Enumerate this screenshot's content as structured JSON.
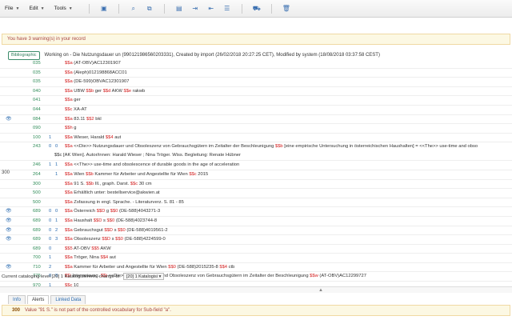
{
  "menus": [
    {
      "label": "File"
    },
    {
      "label": "Edit"
    },
    {
      "label": "Tools"
    }
  ],
  "warning": "You have 3 warning(s) in your record",
  "record": {
    "badge": "Bibliographic",
    "status": "Working on - Die Nutzungsdauer un (990121986560203331), Created by import (26/02/2018 20:27:25 CET), Modified by system (18/08/2018 03:37:58 CEST)"
  },
  "fields": [
    {
      "eye": false,
      "tag": "035",
      "i1": "",
      "i2": "",
      "parts": [
        [
          "$$a",
          " (AT-OBV)AC12301907"
        ]
      ]
    },
    {
      "eye": false,
      "tag": "035",
      "i1": "",
      "i2": "",
      "parts": [
        [
          "$$a",
          " (Aleph)012198868ACC01"
        ]
      ]
    },
    {
      "eye": false,
      "tag": "035",
      "i1": "",
      "i2": "",
      "parts": [
        [
          "$$a",
          " (DE-599)OBVAC12301907"
        ]
      ]
    },
    {
      "eye": false,
      "tag": "040",
      "i1": "",
      "i2": "",
      "parts": [
        [
          "$$a",
          " UBW "
        ],
        [
          "$$b",
          " ger "
        ],
        [
          "$$d",
          " AKW "
        ],
        [
          "$$e",
          " rakwb"
        ]
      ]
    },
    {
      "eye": false,
      "tag": "041",
      "i1": "",
      "i2": "",
      "parts": [
        [
          "$$a",
          " ger"
        ]
      ]
    },
    {
      "eye": false,
      "tag": "044",
      "i1": "",
      "i2": "",
      "parts": [
        [
          "$$c",
          " XA-AT"
        ]
      ]
    },
    {
      "eye": true,
      "tag": "084",
      "i1": "",
      "i2": "",
      "parts": [
        [
          "$$a",
          " 83.11 "
        ],
        [
          "$$2",
          " bkl"
        ]
      ]
    },
    {
      "eye": false,
      "tag": "090",
      "i1": "",
      "i2": "",
      "parts": [
        [
          "$$h",
          " g"
        ]
      ]
    },
    {
      "eye": false,
      "tag": "100",
      "i1": "1",
      "i2": "",
      "parts": [
        [
          "$$a",
          " Wieser, Harald "
        ],
        [
          "$$4",
          " aut"
        ]
      ]
    },
    {
      "eye": false,
      "tag": "243",
      "i1": "0",
      "i2": "0",
      "tall": true,
      "parts": [
        [
          "$$a",
          " <<Die>> Nutzungsdauer und Obsoleszenz von Gebrauchsgütern im Zeitalter der Beschleunigung "
        ],
        [
          "$$b",
          " [eine empirische Untersuchung in österreichischen Haushalten] = <<The>> use-time and obso"
        ]
      ],
      "parts2": [
        [
          "$$c",
          " [AK Wien]. Autor/innen: Harald Wieser ; Nina Tröger. Wiss. Begleitung: Renate Hübner"
        ]
      ]
    },
    {
      "eye": false,
      "tag": "246",
      "i1": "1",
      "i2": "1",
      "parts": [
        [
          "$$a",
          " <<The>> use-time and obsolescence of durable goods in the age of acceleration"
        ]
      ]
    },
    {
      "eye": false,
      "tag": "264",
      "i1": "",
      "i2": "1",
      "parts": [
        [
          "$$a",
          " Wien "
        ],
        [
          "$$b",
          " Kammer für Arbeiter und Angestellte für Wien "
        ],
        [
          "$$c",
          " 2015"
        ]
      ]
    },
    {
      "eye": false,
      "tag": "300",
      "i1": "",
      "i2": "",
      "parts": [
        [
          "$$a",
          " 91 S. "
        ],
        [
          "$$b",
          " Ill., graph. Darst. "
        ],
        [
          "$$c",
          " 30 cm"
        ]
      ]
    },
    {
      "eye": false,
      "tag": "500",
      "i1": "",
      "i2": "",
      "parts": [
        [
          "$$a",
          " Erhältlich unter: bestellservice@akwien.at"
        ]
      ]
    },
    {
      "eye": false,
      "tag": "500",
      "i1": "",
      "i2": "",
      "parts": [
        [
          "$$a",
          " Zsfassung in engl. Sprache. - Literaturverz. S. 81 - 85"
        ]
      ]
    },
    {
      "eye": true,
      "tag": "689",
      "i1": "0",
      "i2": "0",
      "parts": [
        [
          "$$a",
          " Österreich "
        ],
        [
          "$$D",
          " g "
        ],
        [
          "$$0",
          " (DE-588)4043271-3"
        ]
      ]
    },
    {
      "eye": true,
      "tag": "689",
      "i1": "0",
      "i2": "1",
      "parts": [
        [
          "$$a",
          " Haushalt "
        ],
        [
          "$$D",
          " s "
        ],
        [
          "$$0",
          " (DE-588)4023744-8"
        ]
      ]
    },
    {
      "eye": true,
      "tag": "689",
      "i1": "0",
      "i2": "2",
      "parts": [
        [
          "$$a",
          " Gebrauchsgut "
        ],
        [
          "$$D",
          " s "
        ],
        [
          "$$0",
          " (DE-588)4019561-2"
        ]
      ]
    },
    {
      "eye": true,
      "tag": "689",
      "i1": "0",
      "i2": "3",
      "parts": [
        [
          "$$a",
          " Obsoleszenz "
        ],
        [
          "$$D",
          " s "
        ],
        [
          "$$0",
          " (DE-588)4224599-0"
        ]
      ]
    },
    {
      "eye": false,
      "tag": "689",
      "i1": "0",
      "i2": "",
      "parts": [
        [
          "$$5",
          " AT-OBV "
        ],
        [
          "$$5",
          " AKW"
        ]
      ]
    },
    {
      "eye": false,
      "tag": "700",
      "i1": "1",
      "i2": "",
      "parts": [
        [
          "$$a",
          " Tröger, Nina "
        ],
        [
          "$$4",
          " aut"
        ]
      ]
    },
    {
      "eye": true,
      "tag": "710",
      "i1": "2",
      "i2": "",
      "parts": [
        [
          "$$a",
          " Kammer für Arbeiter und Angestellte für Wien "
        ],
        [
          "$$0",
          " (DE-588)2015235-8 "
        ],
        [
          "$$4",
          " ctb"
        ]
      ]
    },
    {
      "eye": false,
      "tag": "775",
      "i1": "0",
      "i2": "8",
      "parts": [
        [
          "$$i",
          " Internetausg. "
        ],
        [
          "$$t",
          " <<Die>> Nutzungsdauer und Obsoleszenz von Gebrauchsgütern im Zeitalter der Beschleunigung "
        ],
        [
          "$$w",
          " (AT-OBV)AC12299727"
        ]
      ]
    },
    {
      "eye": false,
      "tag": "970",
      "i1": "1",
      "i2": "",
      "parts": [
        [
          "$$c",
          " 10"
        ]
      ]
    }
  ],
  "side_marker": "300",
  "level": {
    "label": "Current cataloging level [20] 1 Katalogisiererin, change to:",
    "selected": "[20] 1 Katalogisi"
  },
  "tabs": [
    {
      "label": "Info"
    },
    {
      "label": "Alerts"
    },
    {
      "label": "Linked Data"
    }
  ],
  "alert": {
    "code": "300",
    "message": "Value \"91 S.\" is not part of the controlled vocabulary for Sub-field \"a\"."
  }
}
